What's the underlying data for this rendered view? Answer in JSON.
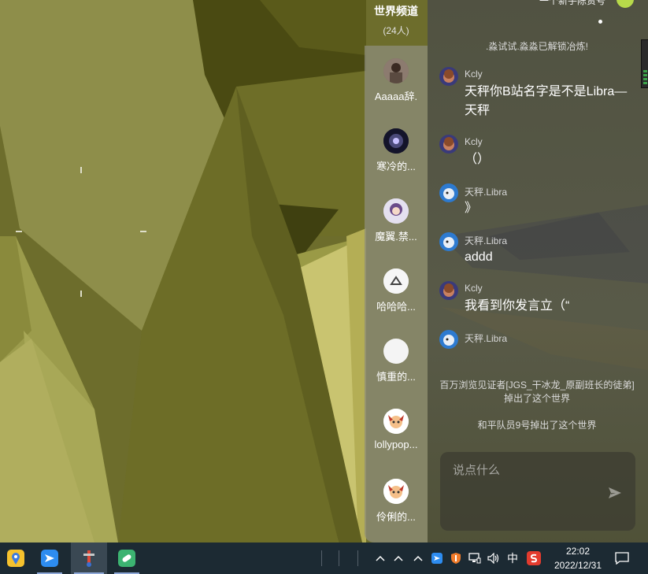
{
  "chat": {
    "channel_title": "世界频道",
    "channel_count": "(24人)",
    "top_notice": "一个新手陈贤号",
    "system_unlock": ".淼试试.淼淼已解锁冶炼!",
    "members": [
      {
        "name": "Aaaaa辞."
      },
      {
        "name": "寒冷的..."
      },
      {
        "name": "魔翼.禁..."
      },
      {
        "name": "哈哈哈..."
      },
      {
        "name": "慎重的..."
      },
      {
        "name": "lollypop..."
      },
      {
        "name": "伶俐的..."
      }
    ],
    "messages": [
      {
        "author": "Kcly",
        "text": "天秤你B站名字是不是Libra—天秤"
      },
      {
        "author": "Kcly",
        "text": "（）"
      },
      {
        "author": "天秤.Libra",
        "text": "》"
      },
      {
        "author": "天秤.Libra",
        "text": "addd"
      },
      {
        "author": "Kcly",
        "text": "我看到你发言立（“"
      },
      {
        "author": "天秤.Libra",
        "text": ""
      }
    ],
    "system_left_1": "百万浏览见证者[JGS_干冰龙_原副班长的徒弟]掉出了这个世界",
    "system_left_2": "和平队员9号掉出了这个世界",
    "input_placeholder": "说点什么"
  },
  "taskbar": {
    "ime_label": "中",
    "time": "22:02",
    "date": "2022/12/31",
    "apps": [
      {
        "icon": "map-app-icon",
        "color": "#f6c22e"
      },
      {
        "icon": "feishu-app-icon",
        "color": "#2d8cf0"
      },
      {
        "icon": "game-app-icon",
        "color": "#e04a3a"
      },
      {
        "icon": "eraser-app-icon",
        "color": "#3cb371"
      }
    ]
  },
  "colors": {
    "taskbar_bg": "#1c2a33",
    "scene_olive": "#7a7a30",
    "accent_blue": "#2d8cf0"
  }
}
